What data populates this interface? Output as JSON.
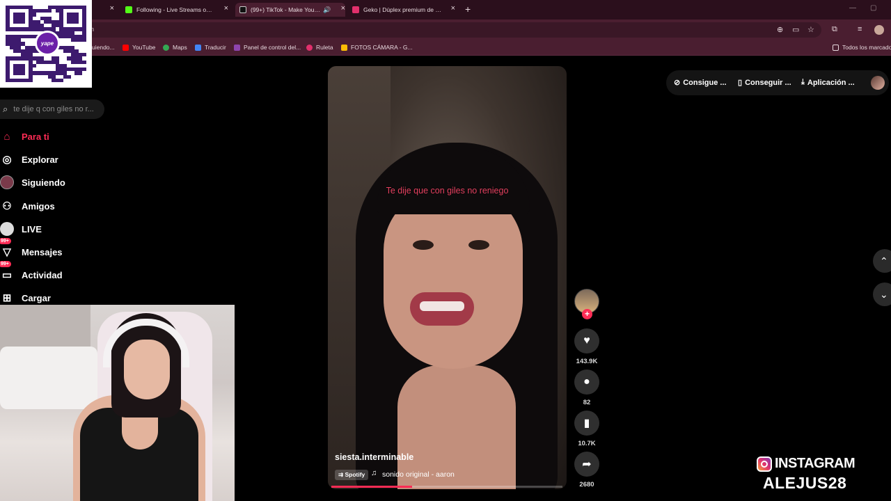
{
  "browser": {
    "tabs": [
      {
        "title": "Following - Live Streams on Ki",
        "color": "#53fc18"
      },
      {
        "title": "(99+) TikTok - Make Your Da",
        "color": "#000000"
      },
      {
        "title": "Geko | Dúplex premium de 2 d",
        "color": "#e1306c"
      }
    ],
    "tab_close": "×",
    "new_tab": "+",
    "address": "n",
    "bookmarks": [
      {
        "label": "uiendo...",
        "color": "#d9c8ce"
      },
      {
        "label": "YouTube",
        "color": "#ff0000"
      },
      {
        "label": "Maps",
        "color": "#34a853"
      },
      {
        "label": "Traducir",
        "color": "#4285f4"
      },
      {
        "label": "Panel de control del...",
        "color": "#8e44ad"
      },
      {
        "label": "Ruleta",
        "color": "#e1306c"
      },
      {
        "label": "FOTOS CÁMARA - G...",
        "color": "#fbbc05"
      }
    ],
    "all_bookmarks": "Todos los marcado"
  },
  "qr": {
    "brand": "yape"
  },
  "sidebar": {
    "search_placeholder": "te dije q con giles no r...",
    "items": [
      {
        "label": "Para ti",
        "icon": "home-icon",
        "glyph": "⌂",
        "active": true
      },
      {
        "label": "Explorar",
        "icon": "compass-icon",
        "glyph": "◎"
      },
      {
        "label": "Siguiendo",
        "icon": "following-avatar-icon",
        "glyph": "●"
      },
      {
        "label": "Amigos",
        "icon": "friends-icon",
        "glyph": "⚇"
      },
      {
        "label": "LIVE",
        "icon": "live-icon",
        "glyph": "●"
      },
      {
        "label": "Mensajes",
        "icon": "messages-icon",
        "glyph": "▽",
        "badge": "99+"
      },
      {
        "label": "Actividad",
        "icon": "activity-icon",
        "glyph": "▭",
        "badge": "99+"
      },
      {
        "label": "Cargar",
        "icon": "upload-icon",
        "glyph": "⊞"
      }
    ]
  },
  "video": {
    "caption": "Te dije que con giles no reniego",
    "author": "siesta.interminable",
    "spotify": "Spotify",
    "sound": "sonido original - aaron",
    "progress": 0.35
  },
  "actions": {
    "likes": "143.9K",
    "comments": "82",
    "saves": "10.7K",
    "shares": "2680"
  },
  "top_right": {
    "coins": "Consigue ...",
    "app": "Conseguir ...",
    "download": "Aplicación ..."
  },
  "overlay": {
    "instagram_label": "INSTAGRAM",
    "instagram_user": "ALEJUS28"
  }
}
